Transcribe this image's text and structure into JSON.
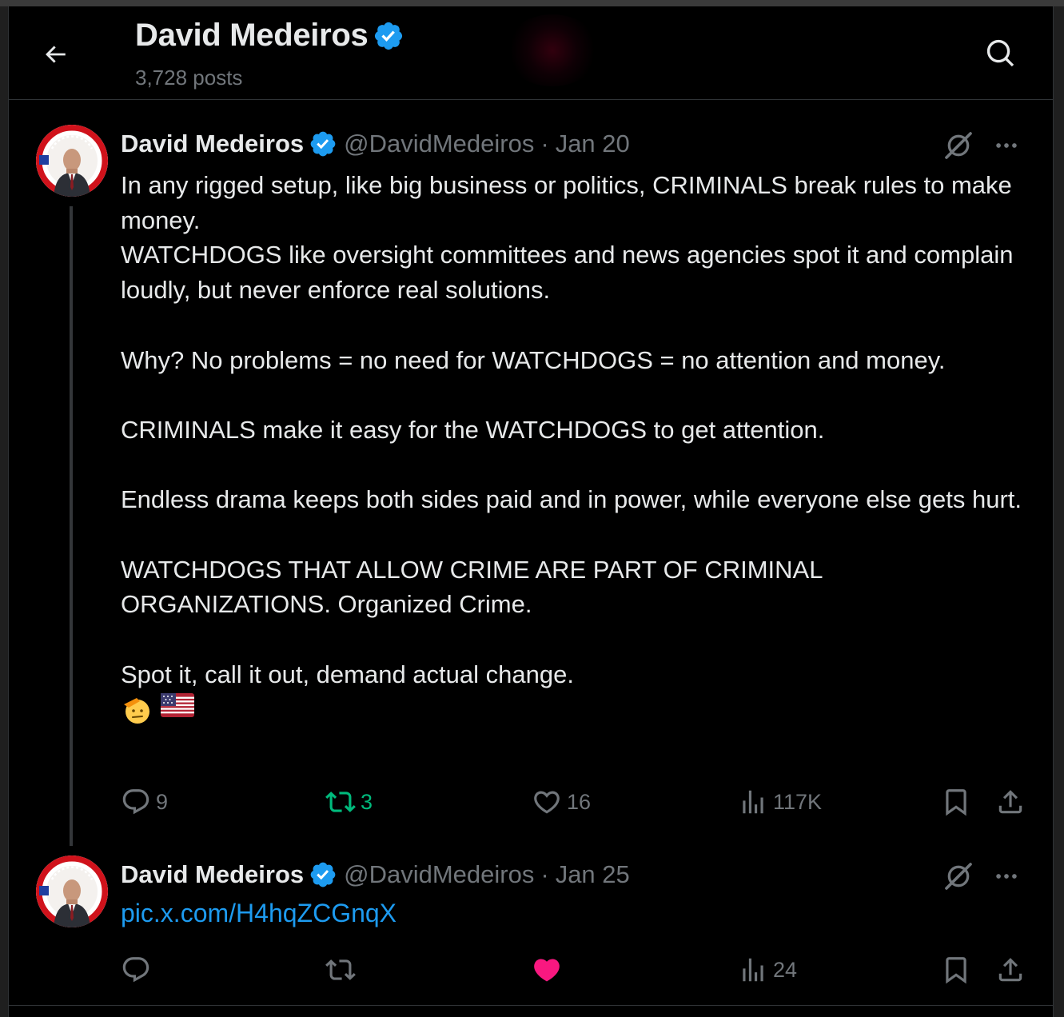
{
  "header": {
    "title": "David Medeiros",
    "posts_count": "3,728 posts"
  },
  "colors": {
    "background": "#000000",
    "text": "#e7e9ea",
    "muted": "#71767b",
    "accent_blue": "#1d9bf0",
    "retweet_green": "#00ba7c",
    "like_pink": "#f91880"
  },
  "tweets": [
    {
      "author": "David Medeiros",
      "handle": "@DavidMedeiros",
      "separator": "·",
      "date": "Jan 20",
      "text": {
        "p1": "In any rigged setup, like big business or politics, CRIMINALS break rules to make money.",
        "p2": "WATCHDOGS like oversight committees and news agencies spot it and complain loudly, but never enforce real solutions.",
        "p3": "Why? No problems = no need for WATCHDOGS = no attention and money.",
        "p4": "CRIMINALS make it easy for the WATCHDOGS to get attention.",
        "p5": "Endless drama keeps both sides paid and in power, while everyone else gets hurt.",
        "p6": "WATCHDOGS THAT ALLOW CRIME ARE PART OF CRIMINAL ORGANIZATIONS.  Organized Crime.",
        "p7": "Spot it, call it out, demand actual change.",
        "emojis": [
          "saluting-face",
          "us-flag"
        ]
      },
      "stats": {
        "replies": "9",
        "reposts": "3",
        "likes": "16",
        "views": "117K"
      }
    },
    {
      "author": "David Medeiros",
      "handle": "@DavidMedeiros",
      "separator": "·",
      "date": "Jan 25",
      "link": "pic.x.com/H4hqZCGnqX",
      "stats": {
        "views": "24"
      }
    }
  ]
}
